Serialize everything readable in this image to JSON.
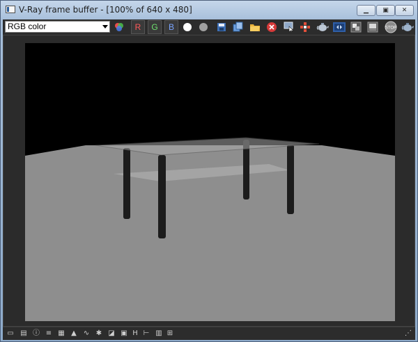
{
  "window": {
    "title": "V-Ray frame buffer - [100% of 640 x 480]",
    "min_glyph": "▁",
    "max_glyph": "▣",
    "close_glyph": "✕"
  },
  "toolbar": {
    "channel": {
      "selected": "RGB color"
    },
    "channels": {
      "r": "R",
      "g": "G",
      "b": "B"
    },
    "stop_label": "STOP"
  },
  "statusbar": {
    "h_label": "H"
  },
  "colors": {
    "toolbar_bg": "#2c2c2c",
    "floor": "#8e8e8e",
    "background": "#000000",
    "table_leg": "#1c1c1c"
  },
  "icons": [
    "color-wheel-icon",
    "white-circle-icon",
    "gray-circle-icon",
    "save-icon",
    "clone-icon",
    "folder-icon",
    "clear-icon",
    "track-mouse-icon",
    "region-render-icon",
    "teapot-icon",
    "lens-effects-icon",
    "link-icon",
    "history-icon",
    "stop-icon",
    "render-teapot-icon"
  ]
}
